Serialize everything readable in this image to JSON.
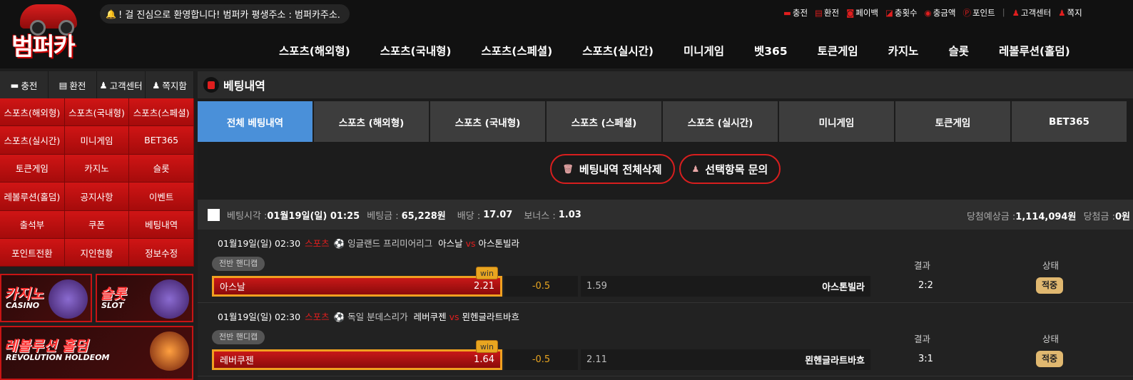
{
  "logo_text": "범퍼카",
  "notice": "! 걸 진심으로 환영합니다! 범퍼카 평생주소 : 범퍼카주소.",
  "util_links": [
    "충전",
    "환전",
    "페이백",
    "충횟수",
    "충금액",
    "포인트",
    "고객센터",
    "쪽지"
  ],
  "main_nav": [
    "스포츠(해외형)",
    "스포츠(국내형)",
    "스포츠(스페셜)",
    "스포츠(실시간)",
    "미니게임",
    "벳365",
    "토큰게임",
    "카지노",
    "슬롯",
    "레볼루션(홀덤)"
  ],
  "sidebar": {
    "top": [
      "충전",
      "환전",
      "고객센터",
      "쪽지함"
    ],
    "grid": [
      "스포츠(해외형)",
      "스포츠(국내형)",
      "스포츠(스페셜)",
      "스포츠(실시간)",
      "미니게임",
      "BET365",
      "토큰게임",
      "카지노",
      "슬롯",
      "레볼루션(홀덤)",
      "공지사항",
      "이벤트",
      "출석부",
      "쿠폰",
      "베팅내역",
      "포인트전환",
      "지인현황",
      "정보수정"
    ],
    "banners": {
      "casino": {
        "t1": "카지노",
        "t2": "CASINO"
      },
      "slot": {
        "t1": "슬롯",
        "t2": "SLOT"
      },
      "holdem": {
        "t1": "레볼루션 홀덤",
        "t2": "REVOLUTION HOLDEOM"
      }
    }
  },
  "page_title": "베팅내역",
  "tabs": [
    "전체 베팅내역",
    "스포츠 (해외형)",
    "스포츠 (국내형)",
    "스포츠 (스페셜)",
    "스포츠 (실시간)",
    "미니게임",
    "토큰게임",
    "BET365"
  ],
  "actions": {
    "delete_all": "베팅내역 전체삭제",
    "inquiry": "선택항목 문의"
  },
  "bet": {
    "time_label": "베팅시각 :",
    "time": "01월19일(일) 01:25",
    "amount_label": "베팅금 :",
    "amount": "65,228원",
    "odds_label": "배당 :",
    "odds": "17.07",
    "bonus_label": "보너스 :",
    "bonus": "1.03",
    "expected_label": "당첨예상금 :",
    "expected": "1,114,094원",
    "win_label": "당첨금 :",
    "win": "0원"
  },
  "games": [
    {
      "datetime": "01월19일(일) 02:30",
      "sport": "스포츠",
      "league": "잉글랜드 프리미어리그",
      "home": "아스날",
      "vs": "vs",
      "away": "아스톤빌라",
      "market": "전반 핸디캡",
      "pick": "아스날",
      "pick_odds": "2.21",
      "badge": "win",
      "handicap": "-0.5",
      "away_odds": "1.59",
      "result_label": "결과",
      "status_label": "상태",
      "score": "2:2",
      "status": "적중"
    },
    {
      "datetime": "01월19일(일) 02:30",
      "sport": "스포츠",
      "league": "독일 분데스리가",
      "home": "레버쿠젠",
      "vs": "vs",
      "away": "묀헨글라트바흐",
      "market": "전반 핸디캡",
      "pick": "레버쿠젠",
      "pick_odds": "1.64",
      "badge": "win",
      "handicap": "-0.5",
      "away_odds": "2.11",
      "result_label": "결과",
      "status_label": "상태",
      "score": "3:1",
      "status": "적중"
    }
  ]
}
